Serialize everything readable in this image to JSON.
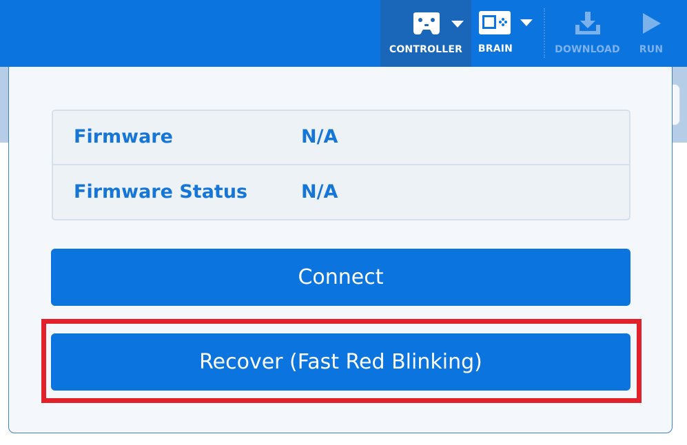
{
  "toolbar": {
    "controller_label": "CONTROLLER",
    "brain_label": "BRAIN",
    "download_label": "DOWNLOAD",
    "run_label": "RUN"
  },
  "panel": {
    "rows": [
      {
        "key": "Firmware",
        "value": "N/A"
      },
      {
        "key": "Firmware Status",
        "value": "N/A"
      }
    ],
    "connect_label": "Connect",
    "recover_label": "Recover (Fast Red Blinking)"
  },
  "colors": {
    "accent": "#0b74de",
    "text_blue": "#1676d8",
    "highlight_red": "#e3212a"
  },
  "icons": [
    "controller-icon",
    "brain-icon",
    "download-icon",
    "run-icon",
    "chevron-down-icon"
  ]
}
